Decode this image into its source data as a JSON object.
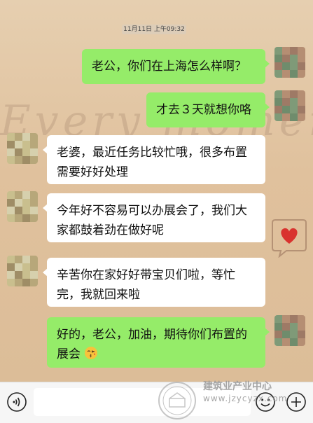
{
  "timestamp": "11月11日 上午09:32",
  "wallpaper": {
    "script_text": "Every moment"
  },
  "messages": [
    {
      "side": "me",
      "text": "老公，你们在上海怎么样啊？"
    },
    {
      "side": "me",
      "text": "才去３天就想你咯"
    },
    {
      "side": "other",
      "text": "老婆，最近任务比较忙哦，很多布置需要好好处理"
    },
    {
      "side": "other",
      "text": "今年好不容易可以办展会了，我们大家都鼓着劲在做好呢"
    },
    {
      "side": "other",
      "text": "辛苦你在家好好带宝贝们啦，等忙完，我就回来啦"
    },
    {
      "side": "me",
      "text": "好的，老公，加油，期待你们布置的展会",
      "emoji": "kissing-heart-emoji"
    }
  ],
  "input_bar": {
    "voice_icon": "voice-icon",
    "emoji_icon": "emoji-icon",
    "plus_icon": "plus-icon",
    "placeholder": ""
  },
  "watermark": {
    "name": "建筑业产业中心",
    "url": "www.jzycyzx.com"
  },
  "colors": {
    "my_bubble": "#95ec69",
    "other_bubble": "#ffffff",
    "bar": "#f6f6f6"
  }
}
